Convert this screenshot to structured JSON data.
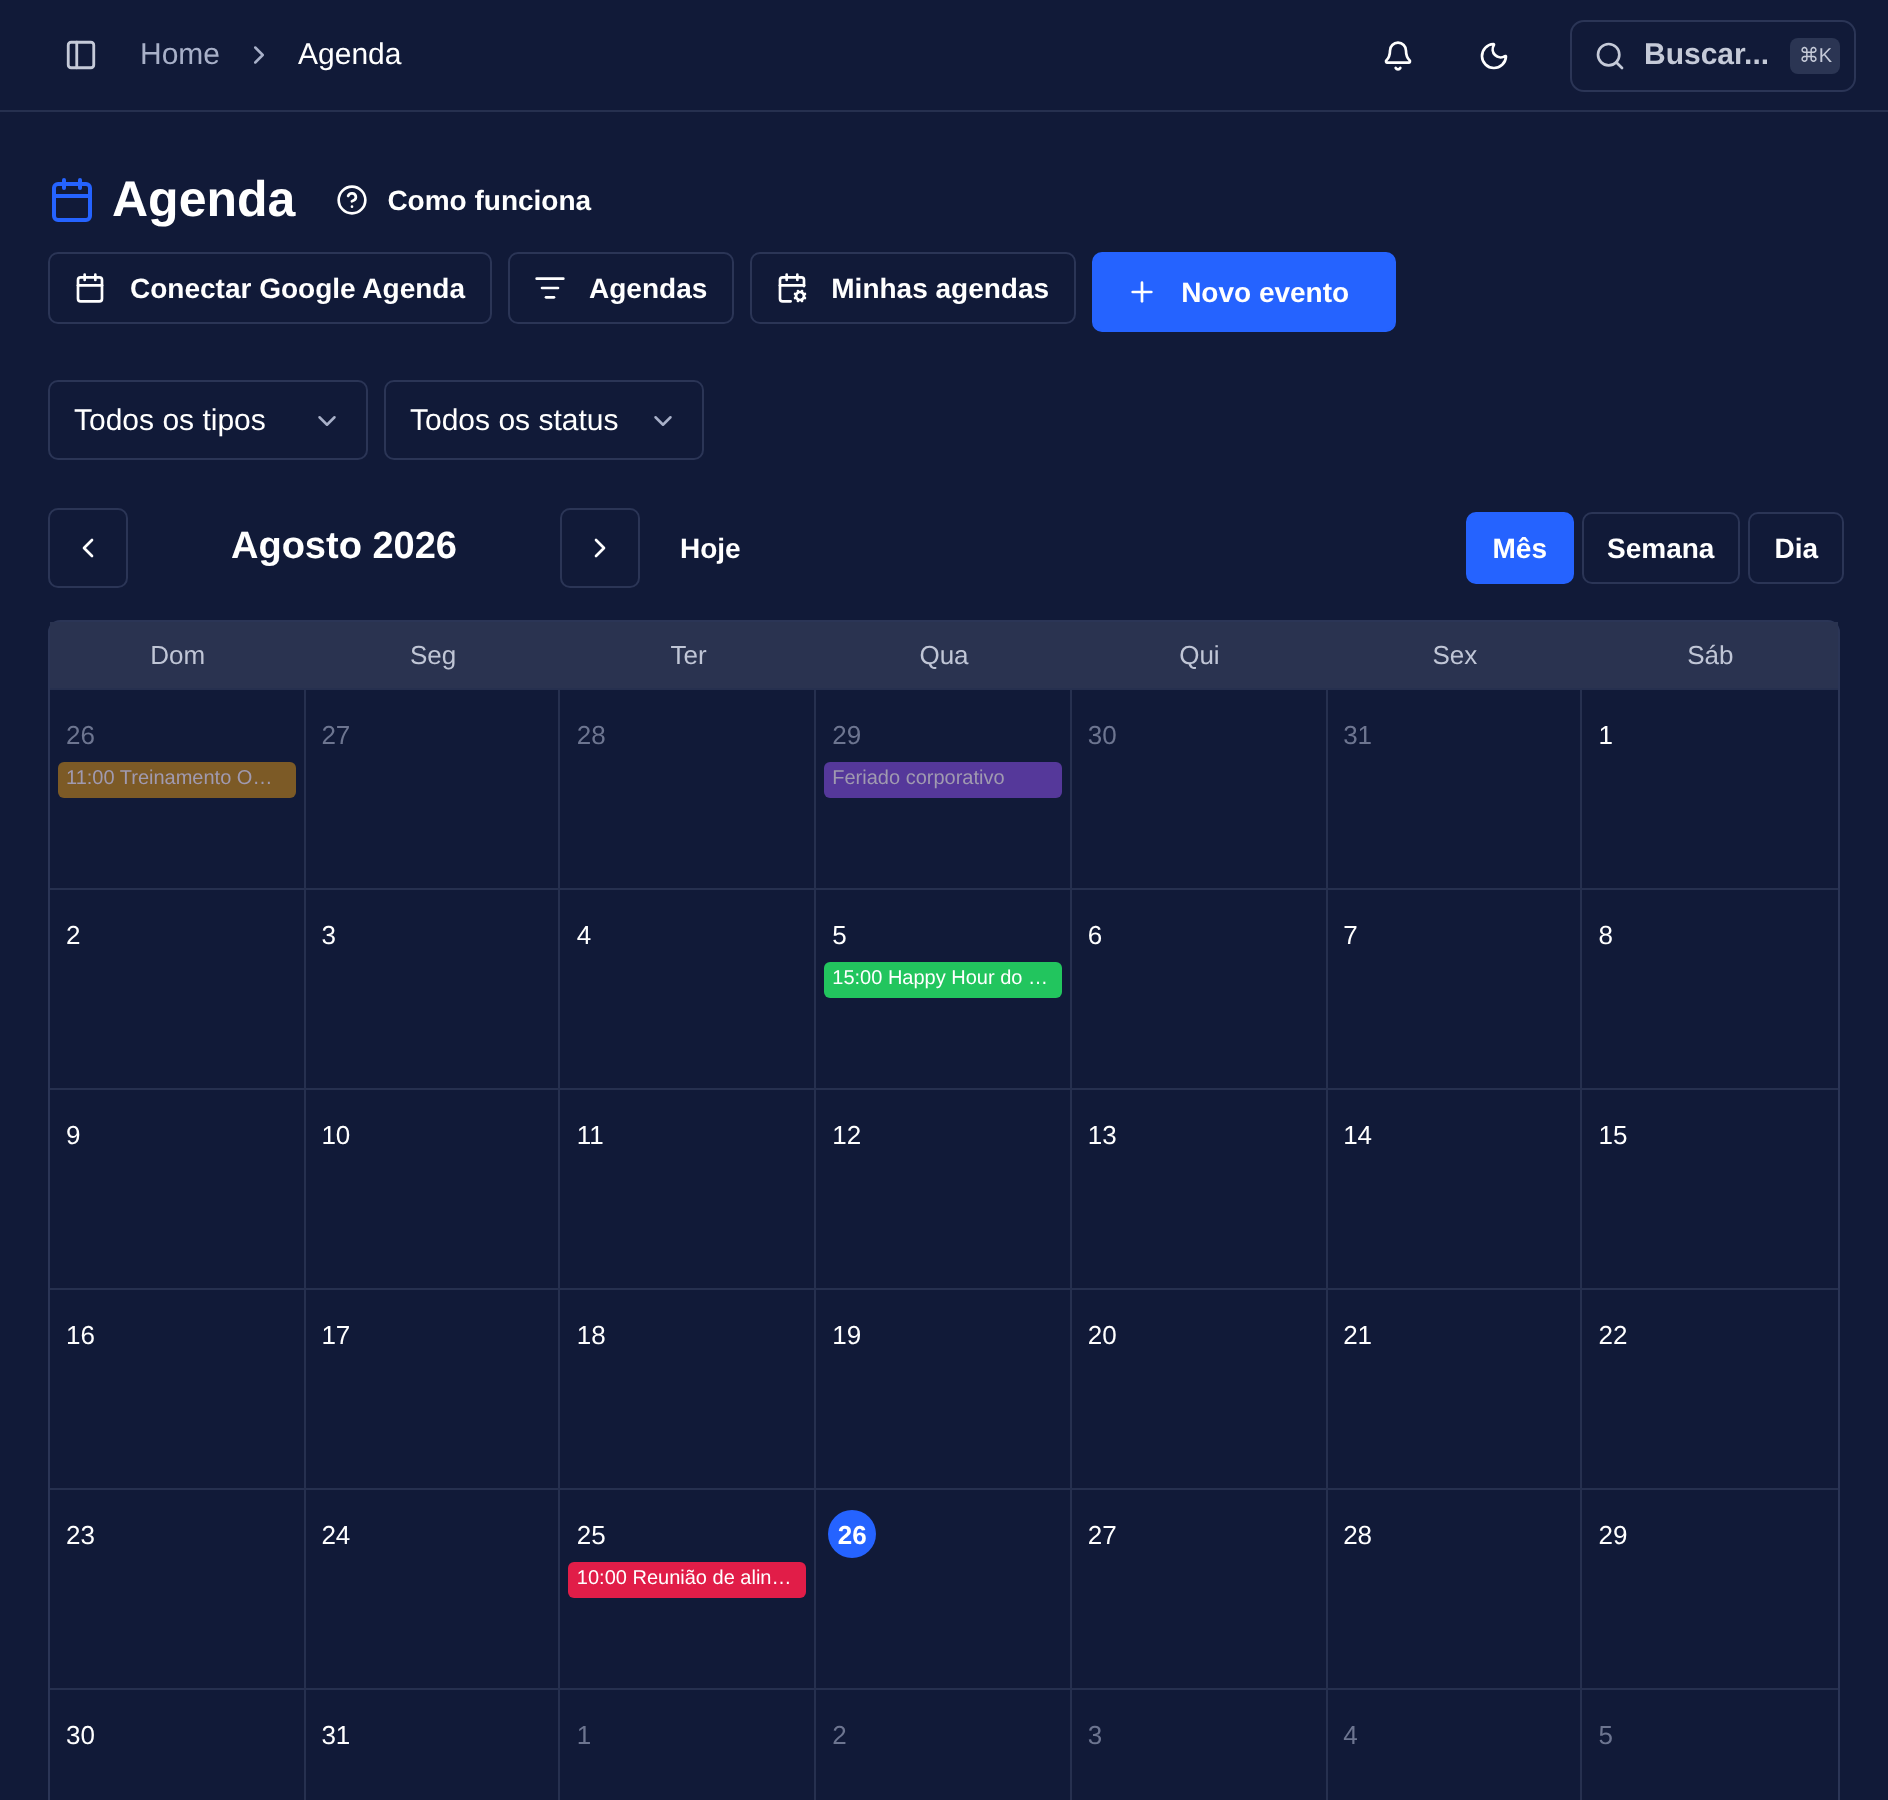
{
  "breadcrumb": [
    "Home",
    "Agenda"
  ],
  "search": {
    "placeholder": "Buscar...",
    "shortcut": "⌘K"
  },
  "page_title": "Agenda",
  "help_link": "Como funciona",
  "actions": [
    {
      "label": "Conectar Google Agenda",
      "kind": "calendar",
      "primary": false
    },
    {
      "label": "Agendas",
      "kind": "filter",
      "primary": false
    },
    {
      "label": "Minhas agendas",
      "kind": "calendar-settings",
      "primary": false
    },
    {
      "label": "Novo evento",
      "kind": "plus",
      "primary": true
    }
  ],
  "filters": [
    "Todos os tipos",
    "Todos os status"
  ],
  "month_label": "Agosto 2026",
  "today_button": "Hoje",
  "views": [
    {
      "label": "Mês",
      "selected": true
    },
    {
      "label": "Semana",
      "selected": false
    },
    {
      "label": "Dia",
      "selected": false
    }
  ],
  "calendar": {
    "weekdays": [
      "Dom",
      "Seg",
      "Ter",
      "Qua",
      "Qui",
      "Sex",
      "Sáb"
    ],
    "weeks": [
      [
        {
          "day": "26",
          "in_month": false,
          "today": false,
          "events": [
            {
              "label": "11:00 Treinamento O…",
              "color": "#7c5a26"
            }
          ]
        },
        {
          "day": "27",
          "in_month": false,
          "today": false
        },
        {
          "day": "28",
          "in_month": false,
          "today": false
        },
        {
          "day": "29",
          "in_month": false,
          "today": false,
          "events": [
            {
              "label": "Feriado corporativo",
              "color": "#55389a"
            }
          ]
        },
        {
          "day": "30",
          "in_month": false,
          "today": false
        },
        {
          "day": "31",
          "in_month": false,
          "today": false
        },
        {
          "day": "1",
          "in_month": true,
          "today": false
        }
      ],
      [
        {
          "day": "2",
          "in_month": true,
          "today": false
        },
        {
          "day": "3",
          "in_month": true,
          "today": false
        },
        {
          "day": "4",
          "in_month": true,
          "today": false
        },
        {
          "day": "5",
          "in_month": true,
          "today": false,
          "events": [
            {
              "label": "15:00 Happy Hour do …",
              "color": "#22c55e"
            }
          ]
        },
        {
          "day": "6",
          "in_month": true,
          "today": false
        },
        {
          "day": "7",
          "in_month": true,
          "today": false
        },
        {
          "day": "8",
          "in_month": true,
          "today": false
        }
      ],
      [
        {
          "day": "9",
          "in_month": true,
          "today": false
        },
        {
          "day": "10",
          "in_month": true,
          "today": false
        },
        {
          "day": "11",
          "in_month": true,
          "today": false
        },
        {
          "day": "12",
          "in_month": true,
          "today": false
        },
        {
          "day": "13",
          "in_month": true,
          "today": false
        },
        {
          "day": "14",
          "in_month": true,
          "today": false
        },
        {
          "day": "15",
          "in_month": true,
          "today": false
        }
      ],
      [
        {
          "day": "16",
          "in_month": true,
          "today": false
        },
        {
          "day": "17",
          "in_month": true,
          "today": false
        },
        {
          "day": "18",
          "in_month": true,
          "today": false
        },
        {
          "day": "19",
          "in_month": true,
          "today": false
        },
        {
          "day": "20",
          "in_month": true,
          "today": false
        },
        {
          "day": "21",
          "in_month": true,
          "today": false
        },
        {
          "day": "22",
          "in_month": true,
          "today": false
        }
      ],
      [
        {
          "day": "23",
          "in_month": true,
          "today": false
        },
        {
          "day": "24",
          "in_month": true,
          "today": false
        },
        {
          "day": "25",
          "in_month": true,
          "today": false,
          "events": [
            {
              "label": "10:00 Reunião de alin…",
              "color": "#e11d48"
            }
          ]
        },
        {
          "day": "26",
          "in_month": true,
          "today": true
        },
        {
          "day": "27",
          "in_month": true,
          "today": false
        },
        {
          "day": "28",
          "in_month": true,
          "today": false
        },
        {
          "day": "29",
          "in_month": true,
          "today": false
        }
      ],
      [
        {
          "day": "30",
          "in_month": true,
          "today": false
        },
        {
          "day": "31",
          "in_month": true,
          "today": false
        },
        {
          "day": "1",
          "in_month": false,
          "today": false
        },
        {
          "day": "2",
          "in_month": false,
          "today": false
        },
        {
          "day": "3",
          "in_month": false,
          "today": false
        },
        {
          "day": "4",
          "in_month": false,
          "today": false
        },
        {
          "day": "5",
          "in_month": false,
          "today": false
        }
      ]
    ]
  }
}
